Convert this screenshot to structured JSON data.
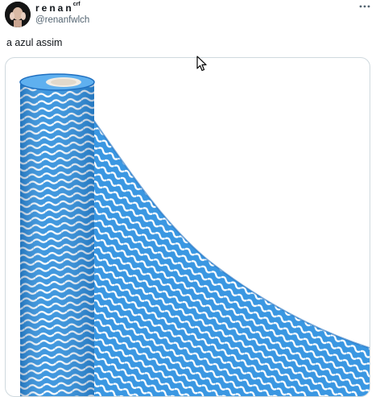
{
  "post": {
    "author": {
      "display_name": "renan",
      "display_name_suffix": "crf",
      "handle": "@renanfwlch",
      "avatar_icon": "avatar-photo"
    },
    "text": "a azul assim",
    "more_icon": "more-horizontal-icon",
    "media": {
      "icon": "blue-wave-cloth-roll-photo",
      "colors": {
        "primary": "#2e8fdd",
        "dark": "#1f6fc0",
        "light": "#5fb0ef"
      }
    }
  },
  "cursor_icon": "mouse-pointer-icon"
}
